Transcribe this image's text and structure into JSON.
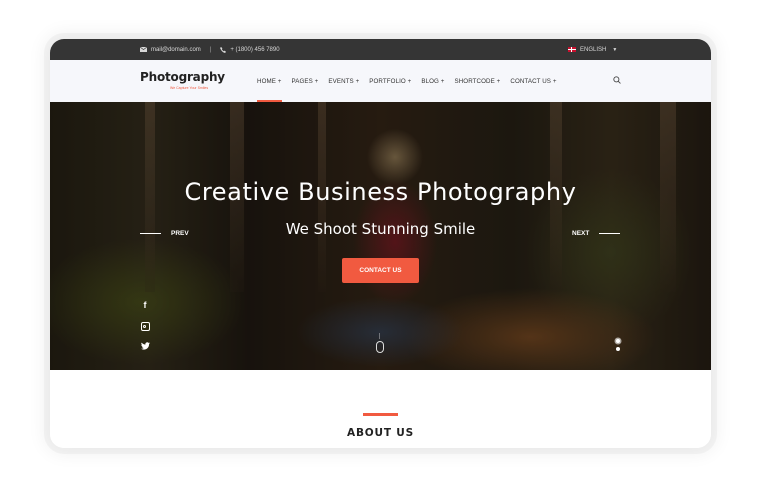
{
  "topbar": {
    "email": "mail@domain.com",
    "phone": "+ (1800) 456 7890",
    "language": "ENGLISH",
    "icons": {
      "email": "envelope-icon",
      "phone": "phone-icon",
      "flag": "uk-flag-icon"
    }
  },
  "header": {
    "logo": "Photography",
    "tagline": "We Capture Your Smiles",
    "menu": [
      {
        "label": "HOME +",
        "active": true
      },
      {
        "label": "PAGES +"
      },
      {
        "label": "EVENTS +"
      },
      {
        "label": "PORTFOLIO +"
      },
      {
        "label": "BLOG +"
      },
      {
        "label": "SHORTCODE +"
      },
      {
        "label": "CONTACT US +"
      }
    ],
    "search_icon": "search-icon"
  },
  "hero": {
    "title": "Creative Business Photography",
    "subtitle": "We Shoot Stunning Smile",
    "prev_label": "PREV",
    "next_label": "NEXT",
    "cta_label": "CONTACT US",
    "social": [
      "facebook-icon",
      "instagram-icon",
      "twitter-icon"
    ],
    "slides_count": 2,
    "active_slide": 1
  },
  "about": {
    "heading": "ABOUT US"
  },
  "colors": {
    "accent": "#f15a40",
    "topbar_bg": "#353535",
    "navbar_bg": "#f6f7fb"
  }
}
